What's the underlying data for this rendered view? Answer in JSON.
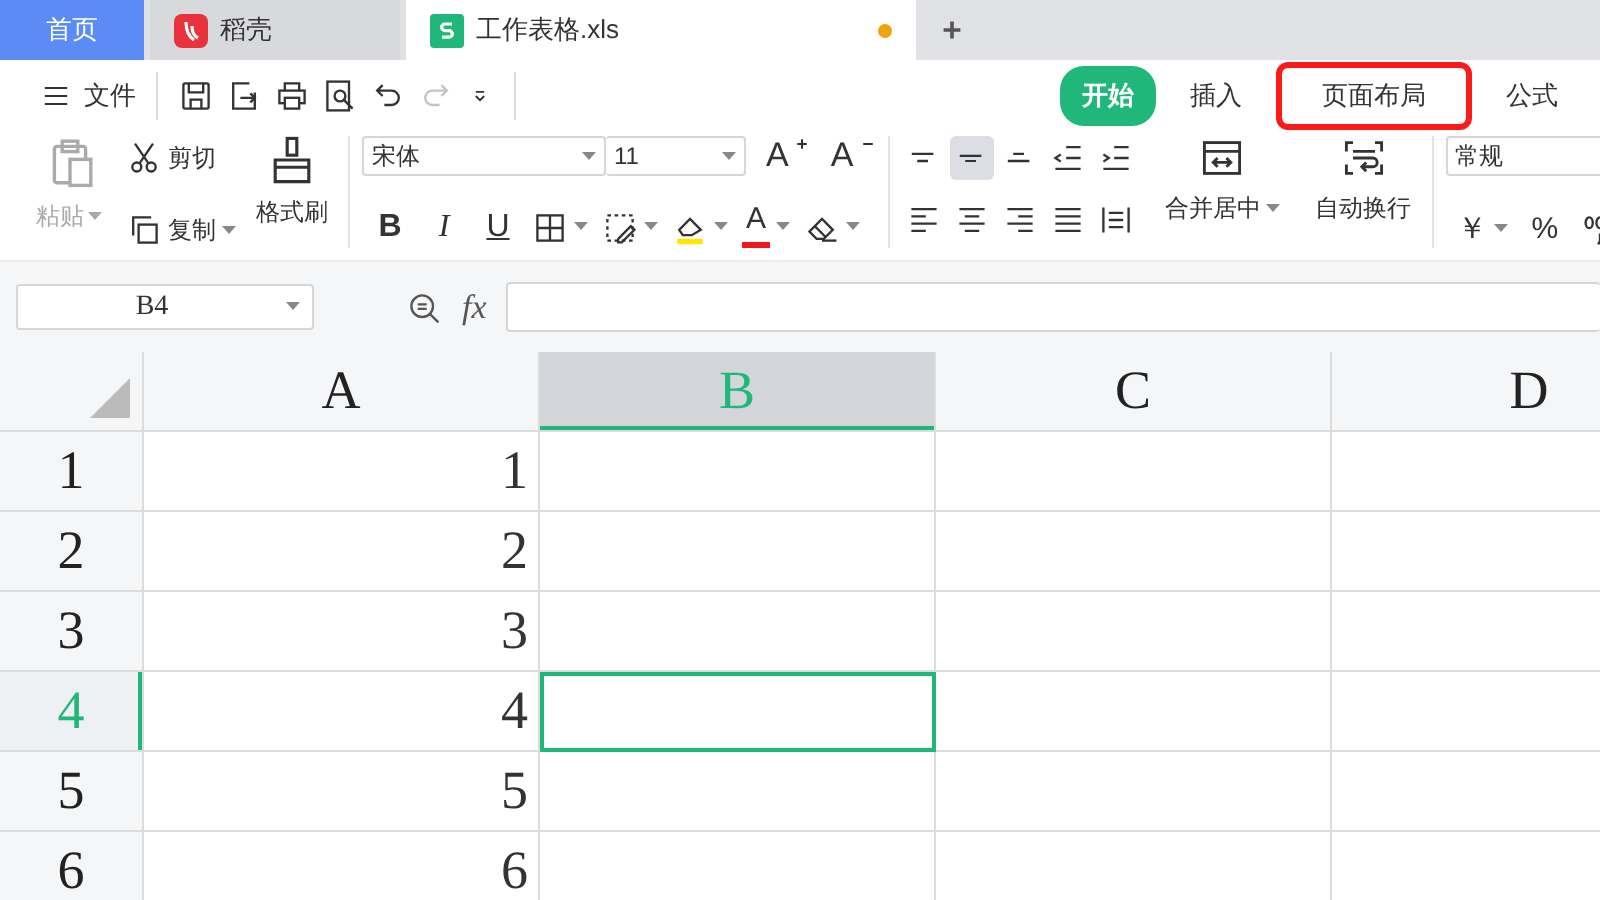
{
  "tabs": [
    {
      "label": "首页",
      "kind": "home",
      "selected": false,
      "unsaved": false
    },
    {
      "label": "稻壳",
      "kind": "docer",
      "selected": false,
      "unsaved": false
    },
    {
      "label": "工作表格.xls",
      "kind": "sheet",
      "selected": true,
      "unsaved": true
    }
  ],
  "menu": {
    "label": "文件"
  },
  "quick_access": [
    {
      "kind": "save",
      "disabled": false
    },
    {
      "kind": "export",
      "disabled": false
    },
    {
      "kind": "print",
      "disabled": false
    },
    {
      "kind": "preview",
      "disabled": false
    },
    {
      "kind": "undo",
      "disabled": false
    },
    {
      "kind": "redo",
      "disabled": true
    },
    {
      "kind": "more",
      "disabled": false
    }
  ],
  "ribbon_tabs": [
    {
      "label": "开始",
      "selected": true,
      "highlighted": false
    },
    {
      "label": "插入",
      "selected": false,
      "highlighted": false
    },
    {
      "label": "页面布局",
      "selected": false,
      "highlighted": true
    },
    {
      "label": "公式",
      "selected": false,
      "highlighted": false
    }
  ],
  "clipboard": {
    "paste": {
      "label": "粘贴",
      "disabled": true
    },
    "cut": {
      "label": "剪切"
    },
    "copy": {
      "label": "复制"
    },
    "format_painter": {
      "label": "格式刷"
    }
  },
  "font": {
    "name": "宋体",
    "size": "11",
    "grow": "A",
    "shrink": "A",
    "bold": "B",
    "italic": "I",
    "underline": "U",
    "font_color": "A"
  },
  "alignment": {
    "buttons": [
      {
        "kind": "top",
        "selected": false
      },
      {
        "kind": "middle",
        "selected": true
      },
      {
        "kind": "bottom",
        "selected": false
      },
      {
        "kind": "outdent",
        "selected": false
      },
      {
        "kind": "indent",
        "selected": false
      },
      {
        "kind": "left",
        "selected": false
      },
      {
        "kind": "center",
        "selected": false
      },
      {
        "kind": "right",
        "selected": false
      },
      {
        "kind": "justify",
        "selected": false
      },
      {
        "kind": "distributed",
        "selected": false
      }
    ],
    "merge": {
      "label": "合并居中"
    },
    "wrap": {
      "label": "自动换行"
    }
  },
  "number": {
    "format": "常规",
    "currency": "￥",
    "percent": "%"
  },
  "formula_bar": {
    "name_box": "B4",
    "function_label": "fx"
  },
  "sheet": {
    "columns": [
      {
        "label": "A",
        "selected": false
      },
      {
        "label": "B",
        "selected": true
      },
      {
        "label": "C",
        "selected": false
      },
      {
        "label": "D",
        "selected": false
      }
    ],
    "rows": [
      {
        "label": "1",
        "selected": false,
        "value": "1"
      },
      {
        "label": "2",
        "selected": false,
        "value": "2"
      },
      {
        "label": "3",
        "selected": false,
        "value": "3"
      },
      {
        "label": "4",
        "selected": true,
        "value": "4"
      },
      {
        "label": "5",
        "selected": false,
        "value": "5"
      },
      {
        "label": "6",
        "selected": false,
        "value": "6"
      }
    ]
  }
}
